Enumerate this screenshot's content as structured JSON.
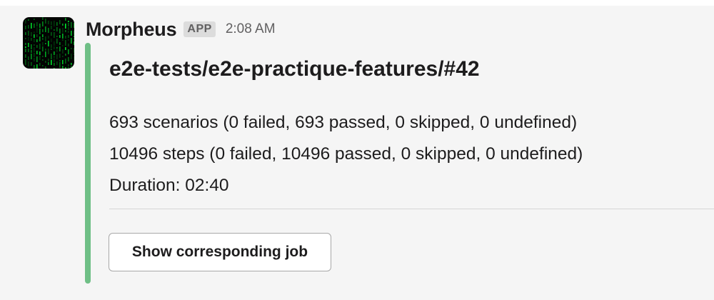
{
  "message": {
    "sender": "Morpheus",
    "app_badge": "APP",
    "timestamp": "2:08 AM",
    "avatar_icon": "matrix-code-icon"
  },
  "attachment": {
    "accent_color": "#6fbf86",
    "title": "e2e-tests/e2e-practique-features/#42",
    "lines": [
      "693 scenarios (0 failed, 693 passed, 0 skipped, 0 undefined)",
      "10496 steps (0 failed, 10496 passed, 0 skipped, 0 undefined)",
      "Duration: 02:40"
    ],
    "button_label": "Show corresponding job"
  }
}
